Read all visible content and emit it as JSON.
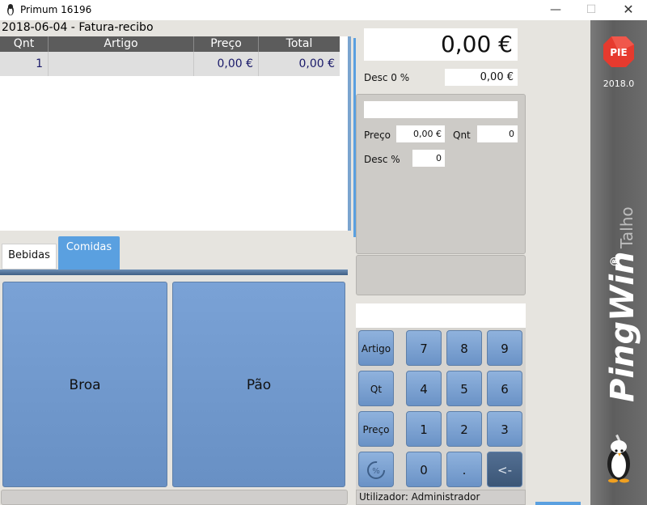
{
  "window": {
    "title": "Primum 16196",
    "minimize_icon": "minimize-icon",
    "maximize_icon": "maximize-icon",
    "close_icon": "close-icon"
  },
  "document": {
    "title": "2018-06-04 - Fatura-recibo"
  },
  "table": {
    "columns": [
      "Qnt",
      "Artigo",
      "Preço",
      "Total"
    ],
    "rows": [
      {
        "qnt": "1",
        "artigo": "",
        "preco": "0,00 €",
        "total": "0,00 €"
      }
    ]
  },
  "tabs": [
    {
      "label": "Bebidas",
      "active": false
    },
    {
      "label": "Comidas",
      "active": true
    }
  ],
  "products": [
    {
      "label": "Broa"
    },
    {
      "label": "Pão"
    }
  ],
  "summary": {
    "total": "0,00 €",
    "desc_label": "Desc 0 %",
    "desc_value": "0,00 €"
  },
  "detail": {
    "input_value": "",
    "preco_label": "Preço",
    "preco_value": "0,00 €",
    "qnt_label": "Qnt",
    "qnt_value": "0",
    "desc_label": "Desc %",
    "desc_value": "0"
  },
  "keypad": {
    "input_value": "",
    "artigo": "Artigo",
    "qt": "Qt",
    "preco": "Preço",
    "k7": "7",
    "k8": "8",
    "k9": "9",
    "k4": "4",
    "k5": "5",
    "k6": "6",
    "k1": "1",
    "k2": "2",
    "k3": "3",
    "k0": "0",
    "dot": ".",
    "back": "<-",
    "discount_icon": "discount-percent-icon"
  },
  "status": {
    "user": "Utilizador: Administrador"
  },
  "brand": {
    "logo_text": "PIE",
    "version": "2018.0",
    "product_name": "PingWin",
    "registered": "®",
    "edition": "Talho",
    "mascot_icon": "penguin-butcher-icon",
    "accent_color": "#e63a2e"
  }
}
